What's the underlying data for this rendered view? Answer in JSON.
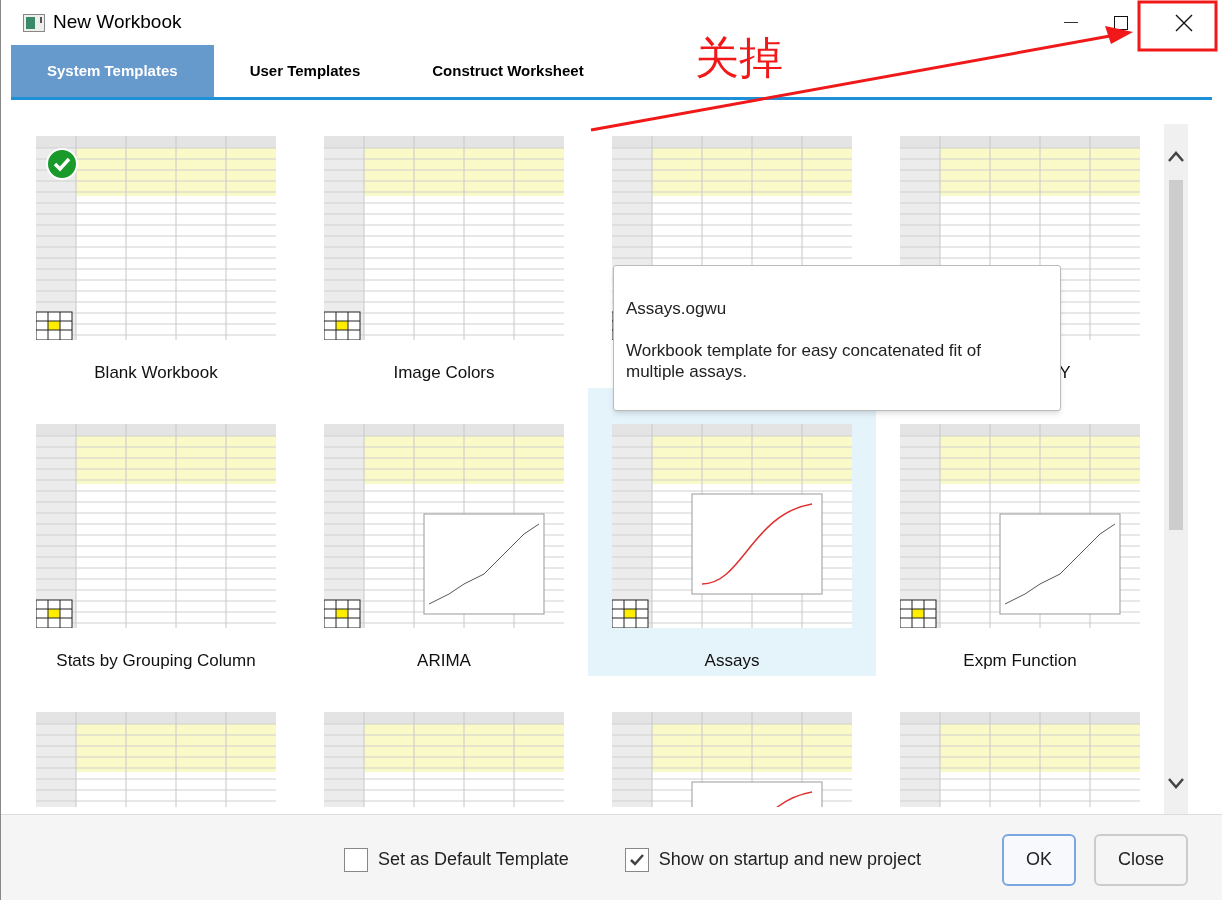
{
  "window": {
    "title": "New Workbook"
  },
  "tabs": [
    {
      "label": "System Templates",
      "selected": true
    },
    {
      "label": "User Templates",
      "selected": false
    },
    {
      "label": "Construct Worksheet",
      "selected": false
    }
  ],
  "templates": [
    {
      "label": "Blank Workbook",
      "selected": false,
      "is_default": true
    },
    {
      "label": "Image Colors",
      "selected": false,
      "is_default": false
    },
    {
      "selected": false,
      "is_default": false
    },
    {
      "label": "Y",
      "selected": false,
      "is_default": false,
      "covered": true
    },
    {
      "label": "Stats by Grouping Column",
      "selected": false,
      "is_default": false
    },
    {
      "label": "ARIMA",
      "selected": false,
      "is_default": false
    },
    {
      "label": "Assays",
      "selected": true,
      "is_default": false
    },
    {
      "label": "Expm Function",
      "selected": false,
      "is_default": false
    },
    {
      "selected": false,
      "is_default": false
    },
    {
      "selected": false,
      "is_default": false
    },
    {
      "selected": false,
      "is_default": false
    },
    {
      "selected": false,
      "is_default": false
    }
  ],
  "tooltip": {
    "title": "Assays.ogwu",
    "text": "Workbook template for easy concatenated fit of multiple assays."
  },
  "options": [
    {
      "label": "Set as Default Template",
      "checked": false
    },
    {
      "label": "Show on startup and new project",
      "checked": true
    }
  ],
  "buttons": [
    {
      "label": "OK",
      "default": true
    },
    {
      "label": "Close",
      "default": false
    }
  ],
  "annotation": {
    "text": "关掉"
  }
}
